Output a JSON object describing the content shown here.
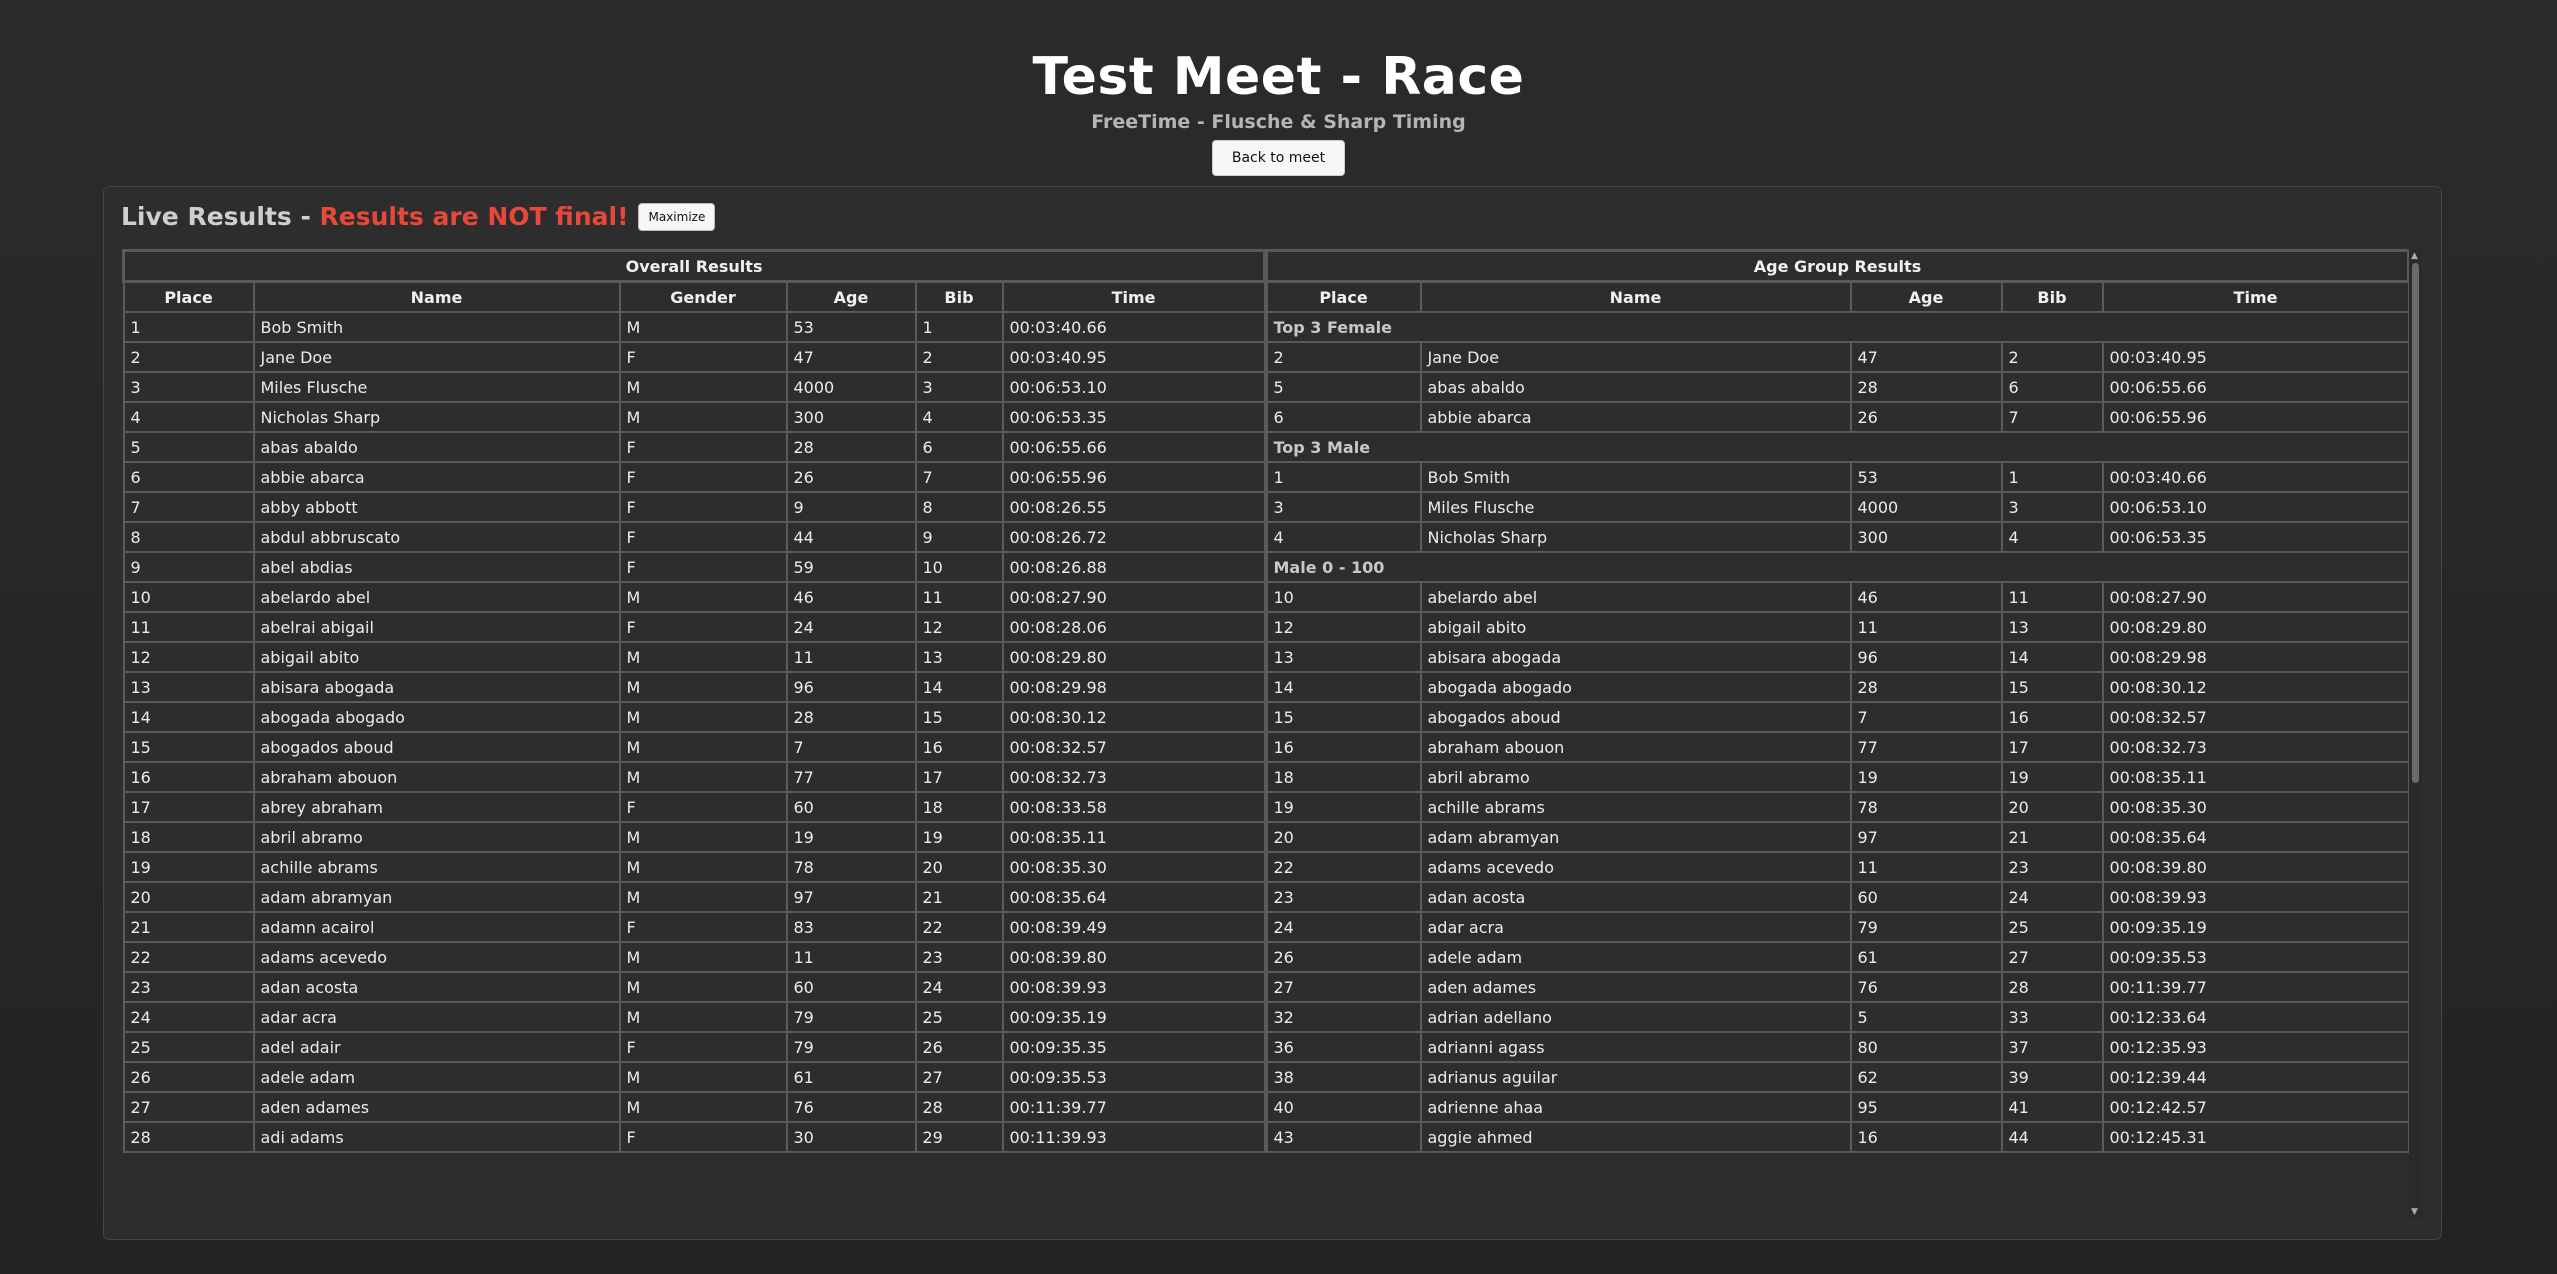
{
  "header": {
    "title": "Test Meet - Race",
    "subtitle": "FreeTime - Flusche & Sharp Timing",
    "back_label": "Back to meet"
  },
  "panel": {
    "title_prefix": "Live Results - ",
    "title_warning": "Results are NOT final!",
    "maximize_label": "Maximize"
  },
  "colors": {
    "warning": "#e8483a",
    "background": "#2b2b2b"
  },
  "overall": {
    "caption": "Overall Results",
    "columns": [
      "Place",
      "Name",
      "Gender",
      "Age",
      "Bib",
      "Time"
    ],
    "rows": [
      [
        "1",
        "Bob Smith",
        "M",
        "53",
        "1",
        "00:03:40.66"
      ],
      [
        "2",
        "Jane Doe",
        "F",
        "47",
        "2",
        "00:03:40.95"
      ],
      [
        "3",
        "Miles Flusche",
        "M",
        "4000",
        "3",
        "00:06:53.10"
      ],
      [
        "4",
        "Nicholas Sharp",
        "M",
        "300",
        "4",
        "00:06:53.35"
      ],
      [
        "5",
        "abas abaldo",
        "F",
        "28",
        "6",
        "00:06:55.66"
      ],
      [
        "6",
        "abbie abarca",
        "F",
        "26",
        "7",
        "00:06:55.96"
      ],
      [
        "7",
        "abby abbott",
        "F",
        "9",
        "8",
        "00:08:26.55"
      ],
      [
        "8",
        "abdul abbruscato",
        "F",
        "44",
        "9",
        "00:08:26.72"
      ],
      [
        "9",
        "abel abdias",
        "F",
        "59",
        "10",
        "00:08:26.88"
      ],
      [
        "10",
        "abelardo abel",
        "M",
        "46",
        "11",
        "00:08:27.90"
      ],
      [
        "11",
        "abelrai abigail",
        "F",
        "24",
        "12",
        "00:08:28.06"
      ],
      [
        "12",
        "abigail abito",
        "M",
        "11",
        "13",
        "00:08:29.80"
      ],
      [
        "13",
        "abisara abogada",
        "M",
        "96",
        "14",
        "00:08:29.98"
      ],
      [
        "14",
        "abogada abogado",
        "M",
        "28",
        "15",
        "00:08:30.12"
      ],
      [
        "15",
        "abogados aboud",
        "M",
        "7",
        "16",
        "00:08:32.57"
      ],
      [
        "16",
        "abraham abouon",
        "M",
        "77",
        "17",
        "00:08:32.73"
      ],
      [
        "17",
        "abrey abraham",
        "F",
        "60",
        "18",
        "00:08:33.58"
      ],
      [
        "18",
        "abril abramo",
        "M",
        "19",
        "19",
        "00:08:35.11"
      ],
      [
        "19",
        "achille abrams",
        "M",
        "78",
        "20",
        "00:08:35.30"
      ],
      [
        "20",
        "adam abramyan",
        "M",
        "97",
        "21",
        "00:08:35.64"
      ],
      [
        "21",
        "adamn acairol",
        "F",
        "83",
        "22",
        "00:08:39.49"
      ],
      [
        "22",
        "adams acevedo",
        "M",
        "11",
        "23",
        "00:08:39.80"
      ],
      [
        "23",
        "adan acosta",
        "M",
        "60",
        "24",
        "00:08:39.93"
      ],
      [
        "24",
        "adar acra",
        "M",
        "79",
        "25",
        "00:09:35.19"
      ],
      [
        "25",
        "adel adair",
        "F",
        "79",
        "26",
        "00:09:35.35"
      ],
      [
        "26",
        "adele adam",
        "M",
        "61",
        "27",
        "00:09:35.53"
      ],
      [
        "27",
        "aden adames",
        "M",
        "76",
        "28",
        "00:11:39.77"
      ],
      [
        "28",
        "adi adams",
        "F",
        "30",
        "29",
        "00:11:39.93"
      ]
    ]
  },
  "age_group": {
    "caption": "Age Group Results",
    "columns": [
      "Place",
      "Name",
      "Age",
      "Bib",
      "Time"
    ],
    "rows": [
      {
        "group": "Top 3 Female"
      },
      [
        "2",
        "Jane Doe",
        "47",
        "2",
        "00:03:40.95"
      ],
      [
        "5",
        "abas abaldo",
        "28",
        "6",
        "00:06:55.66"
      ],
      [
        "6",
        "abbie abarca",
        "26",
        "7",
        "00:06:55.96"
      ],
      {
        "group": "Top 3 Male"
      },
      [
        "1",
        "Bob Smith",
        "53",
        "1",
        "00:03:40.66"
      ],
      [
        "3",
        "Miles Flusche",
        "4000",
        "3",
        "00:06:53.10"
      ],
      [
        "4",
        "Nicholas Sharp",
        "300",
        "4",
        "00:06:53.35"
      ],
      {
        "group": "Male 0 - 100"
      },
      [
        "10",
        "abelardo abel",
        "46",
        "11",
        "00:08:27.90"
      ],
      [
        "12",
        "abigail abito",
        "11",
        "13",
        "00:08:29.80"
      ],
      [
        "13",
        "abisara abogada",
        "96",
        "14",
        "00:08:29.98"
      ],
      [
        "14",
        "abogada abogado",
        "28",
        "15",
        "00:08:30.12"
      ],
      [
        "15",
        "abogados aboud",
        "7",
        "16",
        "00:08:32.57"
      ],
      [
        "16",
        "abraham abouon",
        "77",
        "17",
        "00:08:32.73"
      ],
      [
        "18",
        "abril abramo",
        "19",
        "19",
        "00:08:35.11"
      ],
      [
        "19",
        "achille abrams",
        "78",
        "20",
        "00:08:35.30"
      ],
      [
        "20",
        "adam abramyan",
        "97",
        "21",
        "00:08:35.64"
      ],
      [
        "22",
        "adams acevedo",
        "11",
        "23",
        "00:08:39.80"
      ],
      [
        "23",
        "adan acosta",
        "60",
        "24",
        "00:08:39.93"
      ],
      [
        "24",
        "adar acra",
        "79",
        "25",
        "00:09:35.19"
      ],
      [
        "26",
        "adele adam",
        "61",
        "27",
        "00:09:35.53"
      ],
      [
        "27",
        "aden adames",
        "76",
        "28",
        "00:11:39.77"
      ],
      [
        "32",
        "adrian adellano",
        "5",
        "33",
        "00:12:33.64"
      ],
      [
        "36",
        "adrianni agass",
        "80",
        "37",
        "00:12:35.93"
      ],
      [
        "38",
        "adrianus aguilar",
        "62",
        "39",
        "00:12:39.44"
      ],
      [
        "40",
        "adrienne ahaa",
        "95",
        "41",
        "00:12:42.57"
      ],
      [
        "43",
        "aggie ahmed",
        "16",
        "44",
        "00:12:45.31"
      ]
    ]
  }
}
